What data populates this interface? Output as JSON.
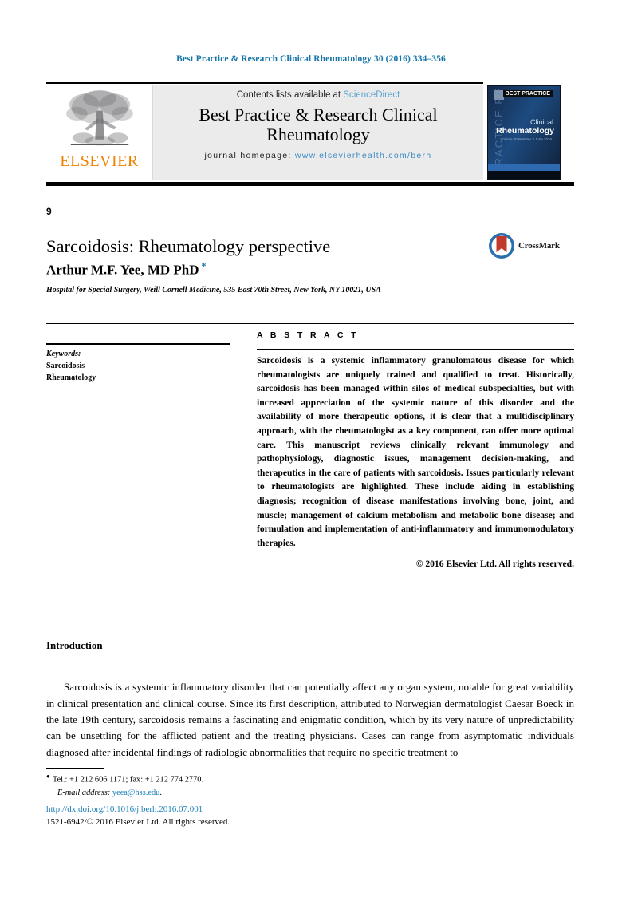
{
  "running_head": "Best Practice & Research Clinical Rheumatology 30 (2016) 334–356",
  "masthead": {
    "publisher_logo_word": "ELSEVIER",
    "contents_prefix": "Contents lists available at ",
    "contents_link": "ScienceDirect",
    "journal_name_line1": "Best Practice & Research Clinical",
    "journal_name_line2": "Rheumatology",
    "homepage_label": "journal homepage: ",
    "homepage_url": "www.elsevierhealth.com/berh",
    "cover": {
      "watermark": "PRACTICE RESEARCH",
      "badge": "BEST PRACTICE",
      "line1": "Clinical",
      "line2": "Rheumatology",
      "line3": "Volume 30 Number 3\nJune 2016"
    }
  },
  "article": {
    "number": "9",
    "title": "Sarcoidosis: Rheumatology perspective",
    "author": "Arthur M.F. Yee, MD PhD",
    "author_mark": "*",
    "affiliation": "Hospital for Special Surgery, Weill Cornell Medicine, 535 East 70th Street, New York, NY 10021, USA",
    "crossmark_label": "CrossMark"
  },
  "keywords": {
    "heading": "Keywords:",
    "items": [
      "Sarcoidosis",
      "Rheumatology"
    ]
  },
  "abstract": {
    "heading": "A B S T R A C T",
    "text": "Sarcoidosis is a systemic inflammatory granulomatous disease for which rheumatologists are uniquely trained and qualified to treat. Historically, sarcoidosis has been managed within silos of medical subspecialties, but with increased appreciation of the systemic nature of this disorder and the availability of more therapeutic options, it is clear that a multidisciplinary approach, with the rheumatologist as a key component, can offer more optimal care. This manuscript reviews clinically relevant immunology and pathophysiology, diagnostic issues, management decision-making, and therapeutics in the care of patients with sarcoidosis. Issues particularly relevant to rheumatologists are highlighted. These include aiding in establishing diagnosis; recognition of disease manifestations involving bone, joint, and muscle; management of calcium metabolism and metabolic bone disease; and formulation and implementation of anti-inflammatory and immunomodulatory therapies.",
    "copyright": "© 2016 Elsevier Ltd. All rights reserved."
  },
  "body": {
    "section_heading": "Introduction",
    "paragraph": "Sarcoidosis is a systemic inflammatory disorder that can potentially affect any organ system, notable for great variability in clinical presentation and clinical course. Since its first description, attributed to Norwegian dermatologist Caesar Boeck in the late 19th century, sarcoidosis remains a fascinating and enigmatic condition, which by its very nature of unpredictability can be unsettling for the afflicted patient and the treating physicians. Cases can range from asymptomatic individuals diagnosed after incidental findings of radiologic abnormalities that require no specific treatment to"
  },
  "footer": {
    "tel_note": "Tel.: +1 212 606 1171; fax: +1 212 774 2770.",
    "email_label": "E-mail address: ",
    "email": "yeea@hss.edu",
    "email_suffix": ".",
    "doi": "http://dx.doi.org/10.1016/j.berh.2016.07.001",
    "issn_line": "1521-6942/© 2016 Elsevier Ltd. All rights reserved."
  },
  "colors": {
    "link_blue": "#1b7fb8",
    "science_direct_blue": "#5ba3d0",
    "elsevier_orange": "#ef8200",
    "masthead_grey": "#ebebeb"
  }
}
